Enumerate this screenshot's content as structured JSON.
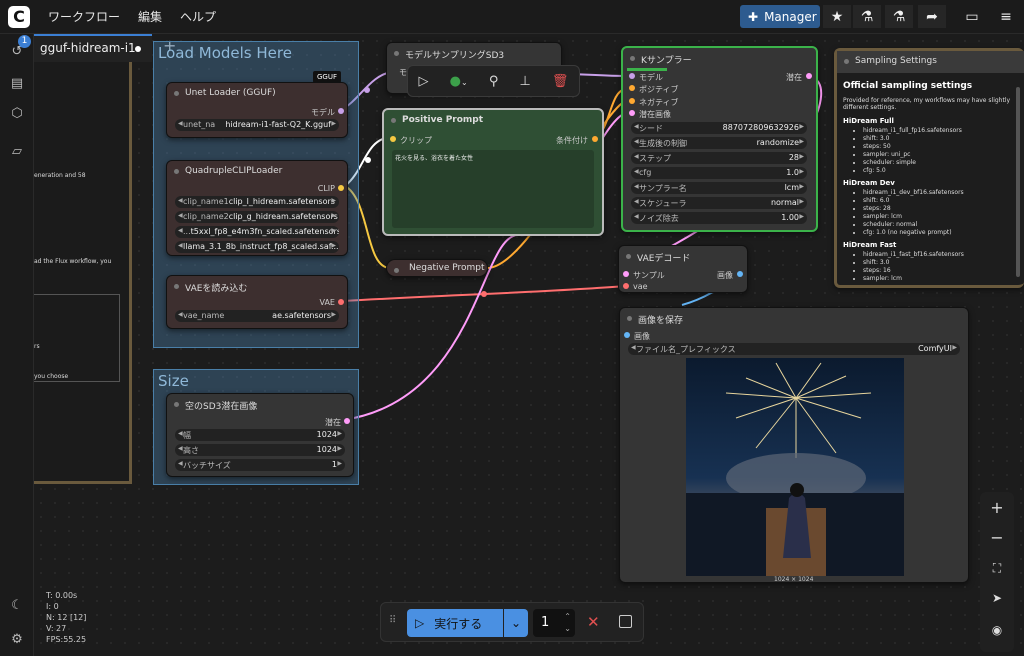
{
  "menu": {
    "workflow": "ワークフロー",
    "edit": "編集",
    "help": "ヘルプ",
    "manager": "Manager"
  },
  "tab": {
    "name": "gguf-hidream-i1",
    "badge": "1"
  },
  "groups": {
    "load": "Load Models Here",
    "size": "Size"
  },
  "left_panel": {
    "t1": "eneration and 58",
    "t2": "ad the Flux workflow, you",
    "t3": "rs",
    "t4": "you choose"
  },
  "unet": {
    "title": "Unet Loader (GGUF)",
    "badge": "GGUF",
    "out": "モデル",
    "w_label": "unet_na",
    "w_value": "hidream-i1-fast-Q2_K.gguf"
  },
  "clip": {
    "title": "QuadrupleCLIPLoader",
    "out": "CLIP",
    "w": [
      {
        "l": "clip_name1",
        "v": "clip_l_hidream.safetensors"
      },
      {
        "l": "clip_name2",
        "v": "clip_g_hidream.safetensors"
      },
      {
        "l": "...",
        "v": "t5xxl_fp8_e4m3fn_scaled.safetensors"
      },
      {
        "l": "",
        "v": "llama_3.1_8b_instruct_fp8_scaled.saf..."
      }
    ]
  },
  "vae": {
    "title": "VAEを読み込む",
    "out": "VAE",
    "w_label": "vae_name",
    "w_value": "ae.safetensors"
  },
  "latent": {
    "title": "空のSD3潜在画像",
    "out": "潜在",
    "w": [
      {
        "l": "幅",
        "v": "1024"
      },
      {
        "l": "高さ",
        "v": "1024"
      },
      {
        "l": "バッチサイズ",
        "v": "1"
      }
    ]
  },
  "msd3": {
    "title": "モデルサンプリングSD3",
    "in": "モ"
  },
  "positive": {
    "title": "Positive Prompt",
    "in": "クリップ",
    "out": "条件付け",
    "text": "花火を見る、浴衣を着た女性"
  },
  "negative": {
    "title": "Negative Prompt"
  },
  "ksampler": {
    "title": "Kサンプラー",
    "out": "潜在",
    "inputs": [
      "モデル",
      "ポジティブ",
      "ネガティブ",
      "潜在画像"
    ],
    "w": [
      {
        "l": "シード",
        "v": "887072809632926"
      },
      {
        "l": "生成後の制御",
        "v": "randomize"
      },
      {
        "l": "ステップ",
        "v": "28"
      },
      {
        "l": "cfg",
        "v": "1.0"
      },
      {
        "l": "サンプラー名",
        "v": "lcm"
      },
      {
        "l": "スケジューラ",
        "v": "normal"
      },
      {
        "l": "ノイズ除去",
        "v": "1.00"
      }
    ]
  },
  "vaedecode": {
    "title": "VAEデコード",
    "in1": "サンプル",
    "in2": "vae",
    "out": "画像"
  },
  "save": {
    "title": "画像を保存",
    "in": "画像",
    "w_label": "ファイル名_プレフィックス",
    "w_value": "ComfyUI",
    "size": "1024 × 1024"
  },
  "settings": {
    "title": "Sampling Settings",
    "heading": "Official sampling settings",
    "intro": "Provided for reference, my workflows may have slightly different settings.",
    "sections": [
      {
        "h": "HiDream Full",
        "items": [
          "hidream_i1_full_fp16.safetensors",
          "shift: 3.0",
          "steps: 50",
          "sampler: uni_pc",
          "scheduler: simple",
          "cfg: 5.0"
        ]
      },
      {
        "h": "HiDream Dev",
        "items": [
          "hidream_i1_dev_bf16.safetensors",
          "shift: 6.0",
          "steps: 28",
          "sampler: lcm",
          "scheduler: normal",
          "cfg: 1.0 (no negative prompt)"
        ]
      },
      {
        "h": "HiDream Fast",
        "items": [
          "hidream_i1_fast_bf16.safetensors",
          "shift: 3.0",
          "steps: 16",
          "sampler: lcm"
        ]
      }
    ]
  },
  "run": {
    "label": "実行する",
    "count": "1"
  },
  "stats": {
    "t": "T: 0.00s",
    "i": "I: 0",
    "n": "N: 12 [12]",
    "v": "V: 27",
    "fps": "FPS:55.25"
  },
  "colors": {
    "accent": "#3b7fd4",
    "model": "#c7a0e8",
    "clip": "#f5c842",
    "vae": "#ff6e6e",
    "cond": "#ffa931",
    "latent": "#ff9cf9",
    "image": "#64b5f6"
  }
}
